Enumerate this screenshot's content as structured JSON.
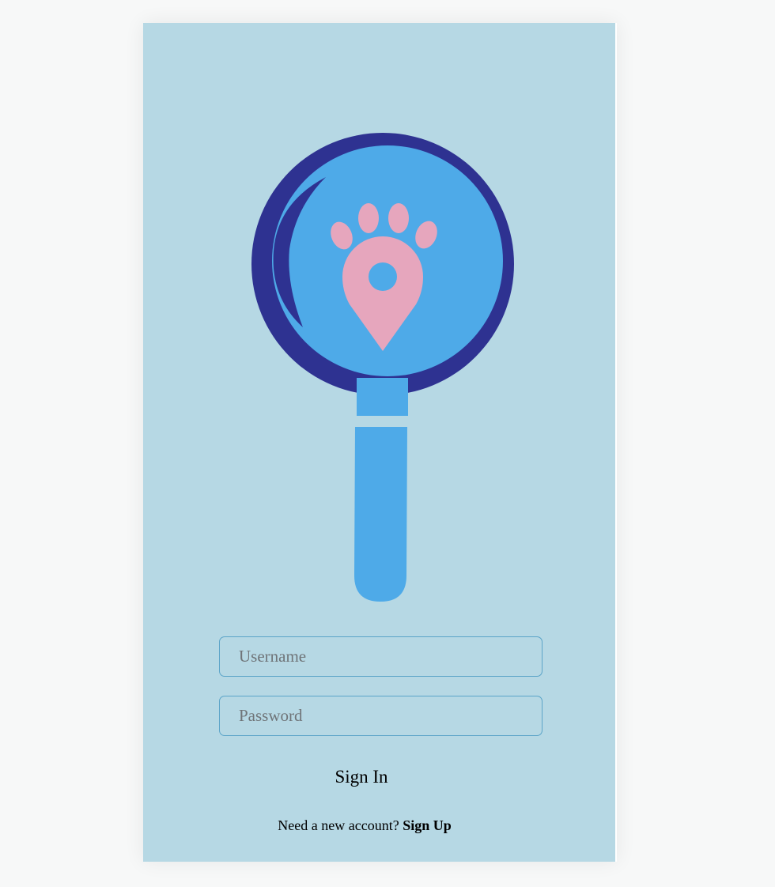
{
  "logo": {
    "icon": "paw-location-magnifier-logo",
    "colors": {
      "ring": "#2e3291",
      "lens": "#4eaae8",
      "paw": "#e6a6bd"
    }
  },
  "form": {
    "username_placeholder": "Username",
    "password_placeholder": "Password",
    "signin_label": "Sign In",
    "signup_prompt": "Need a new account?",
    "signup_link": "Sign Up"
  },
  "colors": {
    "page_background": "#f7f8f8",
    "card_background": "#b6d8e4",
    "input_border": "#5ba4c8"
  }
}
